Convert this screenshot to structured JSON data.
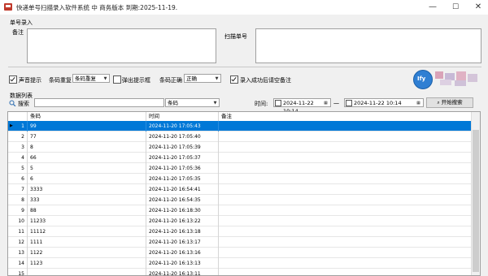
{
  "window": {
    "title": "快递单号扫描录入软件系统  中 商务版本  到期:2025-11-19.",
    "minimize": "—",
    "maximize": "☐",
    "close": "✕"
  },
  "entry": {
    "group_label": "单号录入",
    "remark_label": "备注",
    "scan_label": "扫描单号",
    "remark_value": "",
    "scan_value": ""
  },
  "options": {
    "sound_label": "声音提示",
    "sound_checked": true,
    "dup_label": "条码重复",
    "dup_value": "条码重复",
    "popup_label": "弹出提示框",
    "popup_checked": false,
    "correct_label": "条码正确",
    "correct_value": "正确",
    "clear_label": "录入成功后请空备注",
    "clear_checked": true,
    "logo_badge": "Ify"
  },
  "list": {
    "group_label": "数据列表",
    "search_label": "搜索",
    "search_value": "",
    "field_value": "条码",
    "time_label": "时间:",
    "from_value": "2024-11-22 10:14",
    "dash": "一",
    "to_value": "2024-11-22 10:14",
    "start_button": "开始搜索"
  },
  "grid": {
    "columns": [
      "条码",
      "时间",
      "备注"
    ],
    "rows": [
      {
        "n": "1",
        "code": "99",
        "time": "2024-11-20 17:05:43",
        "note": ""
      },
      {
        "n": "2",
        "code": "77",
        "time": "2024-11-20 17:05:40",
        "note": ""
      },
      {
        "n": "3",
        "code": "8",
        "time": "2024-11-20 17:05:39",
        "note": ""
      },
      {
        "n": "4",
        "code": "66",
        "time": "2024-11-20 17:05:37",
        "note": ""
      },
      {
        "n": "5",
        "code": "5",
        "time": "2024-11-20 17:05:36",
        "note": ""
      },
      {
        "n": "6",
        "code": "6",
        "time": "2024-11-20 17:05:35",
        "note": ""
      },
      {
        "n": "7",
        "code": "3333",
        "time": "2024-11-20 16:54:41",
        "note": ""
      },
      {
        "n": "8",
        "code": "333",
        "time": "2024-11-20 16:54:35",
        "note": ""
      },
      {
        "n": "9",
        "code": "88",
        "time": "2024-11-20 16:18:30",
        "note": ""
      },
      {
        "n": "10",
        "code": "11233",
        "time": "2024-11-20 16:13:22",
        "note": ""
      },
      {
        "n": "11",
        "code": "11112",
        "time": "2024-11-20 16:13:18",
        "note": ""
      },
      {
        "n": "12",
        "code": "1111",
        "time": "2024-11-20 16:13:17",
        "note": ""
      },
      {
        "n": "13",
        "code": "1122",
        "time": "2024-11-20 16:13:16",
        "note": ""
      },
      {
        "n": "14",
        "code": "1123",
        "time": "2024-11-20 16:13:13",
        "note": ""
      },
      {
        "n": "15",
        "code": "",
        "time": "2024-11-20 16:13:11",
        "note": ""
      }
    ]
  },
  "colors": {
    "selection": "#0078d7",
    "accent": "#c0392b"
  }
}
